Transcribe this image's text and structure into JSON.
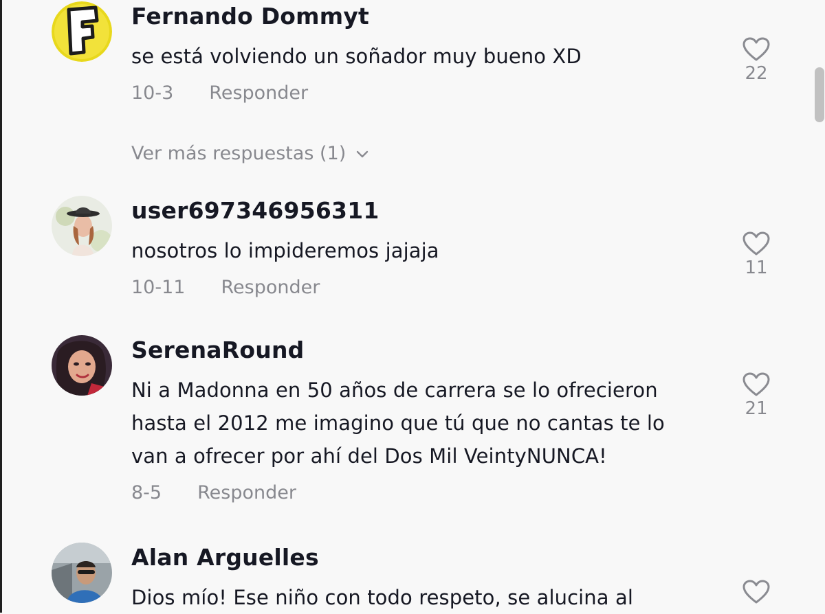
{
  "comments": [
    {
      "username": "Fernando Dommyt",
      "text": "se está volviendo un soñador muy bueno XD",
      "date": "10-3",
      "reply_label": "Responder",
      "likes": "22",
      "avatar": "yellow-F-logo-avatar",
      "more_replies": "Ver más respuestas (1)"
    },
    {
      "username": "user697346956311",
      "text": "nosotros lo impideremos jajaja",
      "date": "10-11",
      "reply_label": "Responder",
      "likes": "11",
      "avatar": "woman-with-hat-photo-avatar"
    },
    {
      "username": "SerenaRound",
      "text": "Ni a Madonna en 50 años de carrera se lo ofrecieron hasta el 2012 me imagino que tú que no cantas te lo van a ofrecer por ahí del Dos Mil VeintyNUNCA!",
      "date": "8-5",
      "reply_label": "Responder",
      "likes": "21",
      "avatar": "woman-selfie-photo-avatar"
    },
    {
      "username": "Alan Arguelles",
      "text": "Dios mío! Ese niño con todo respeto, se alucina al",
      "avatar": "man-in-car-photo-avatar"
    }
  ],
  "icons": {
    "like": "heart-outline-icon",
    "expand": "chevron-down-icon"
  },
  "colors": {
    "background": "#f8f8f8",
    "text": "#161823",
    "muted": "#8a8b91",
    "avatar_yellow": "#e8d81c"
  }
}
